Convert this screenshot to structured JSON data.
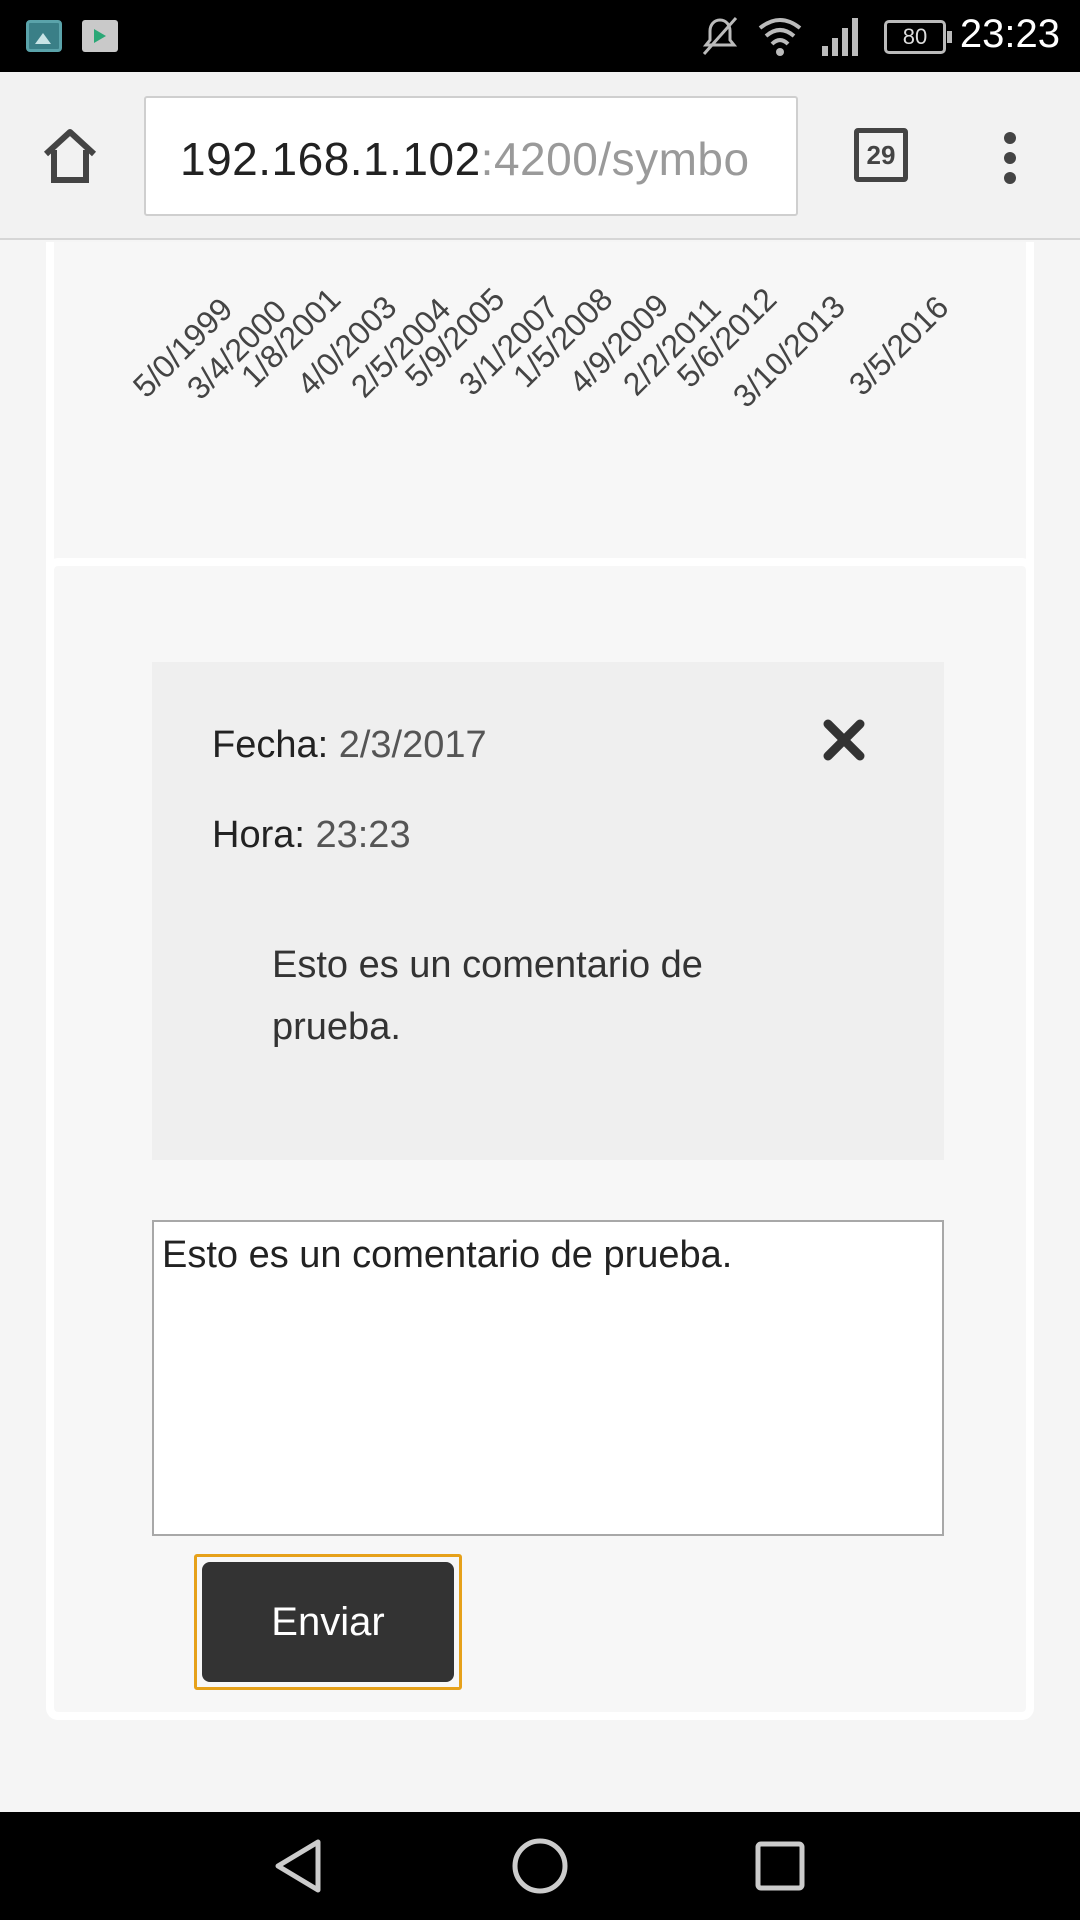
{
  "status_bar": {
    "battery": "80",
    "time": "23:23"
  },
  "browser": {
    "url_host": "192.168.1.102",
    "url_path": ":4200/symbo",
    "tab_count": "29"
  },
  "chart_axis": {
    "tick_labels": [
      "5/0/1999",
      "3/4/2000",
      "1/8/2001",
      "4/0/2003",
      "2/5/2004",
      "5/9/2005",
      "3/1/2007",
      "1/5/2008",
      "4/9/2009",
      "2/2/2011",
      "5/6/2012",
      "3/10/2013",
      "3/5/2016"
    ]
  },
  "comment": {
    "date_label": "Fecha:",
    "date_value": "2/3/2017",
    "time_label": "Hora:",
    "time_value": "23:23",
    "text": "Esto es un comentario de prueba."
  },
  "form": {
    "textarea_value": "Esto es un comentario de prueba.",
    "submit_label": "Enviar"
  },
  "colors": {
    "focus_outline": "#e6a11a",
    "button_bg": "#333333"
  }
}
